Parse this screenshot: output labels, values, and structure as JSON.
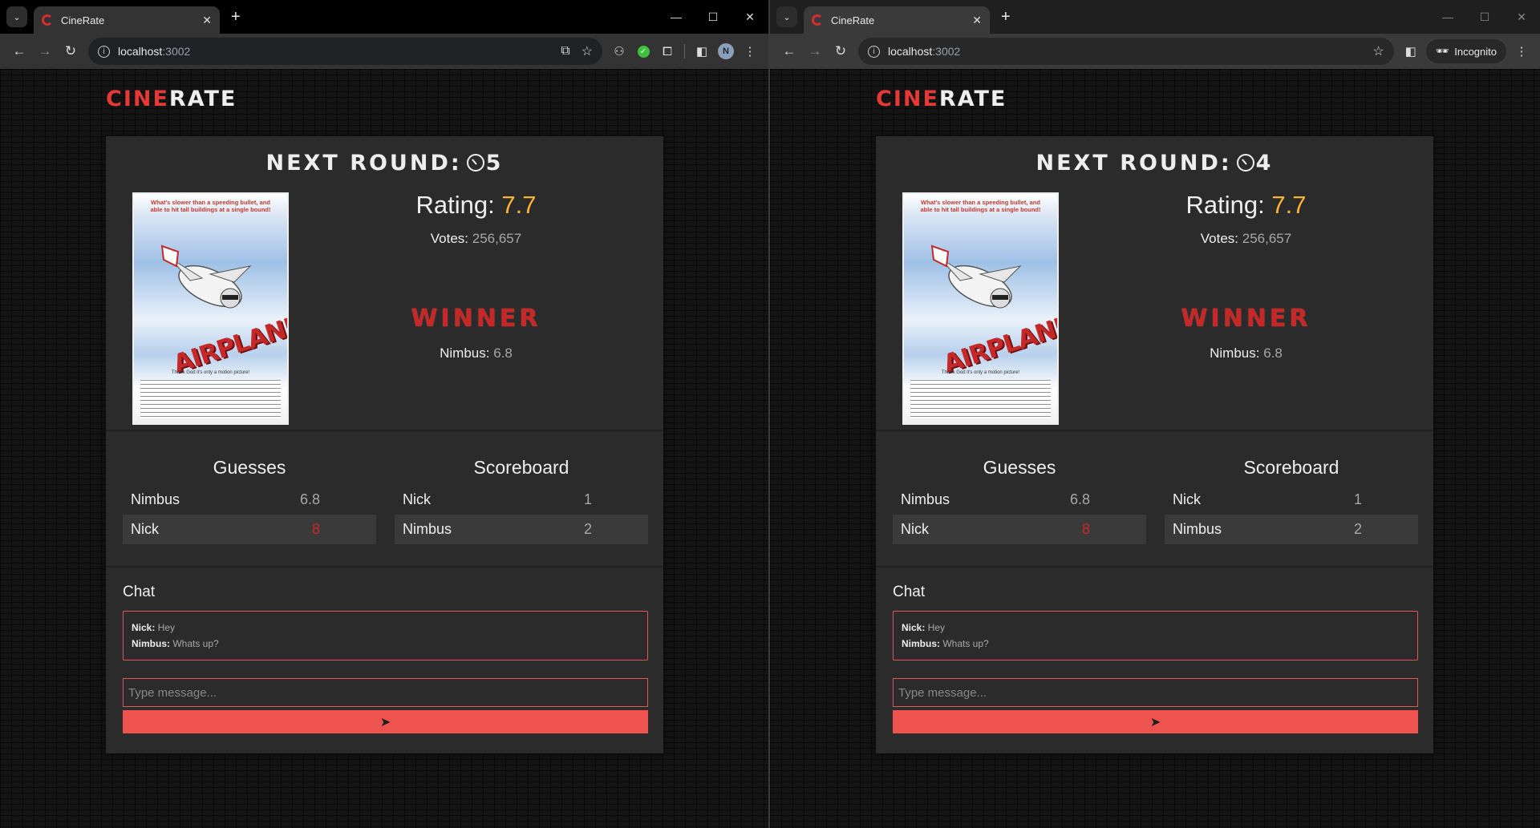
{
  "windows": [
    {
      "tab": {
        "title": "CineRate"
      },
      "url": {
        "host": "localhost",
        "port": ":3002"
      },
      "mode": "normal",
      "avatar_initial": "N",
      "page": {
        "logo": {
          "red": "CINE",
          "white": "RATE"
        },
        "round": {
          "label": "NEXT ROUND:",
          "countdown": "5"
        },
        "poster": {
          "tagline": "What's slower than a speeding bullet, and able to hit tall buildings at a single bound!",
          "title_art": "AIRPLANE!",
          "small_line": "Thank God it's only a motion picture!"
        },
        "rating": {
          "label": "Rating:",
          "value": "7.7"
        },
        "votes": {
          "label": "Votes:",
          "value": "256,657"
        },
        "winner": {
          "label": "WINNER",
          "name": "Nimbus:",
          "value": "6.8"
        },
        "guesses": {
          "title": "Guesses",
          "rows": [
            {
              "name": "Nimbus",
              "value": "6.8"
            },
            {
              "name": "Nick",
              "value": "8"
            }
          ]
        },
        "scoreboard": {
          "title": "Scoreboard",
          "rows": [
            {
              "name": "Nick",
              "value": "1"
            },
            {
              "name": "Nimbus",
              "value": "2"
            }
          ]
        },
        "chat": {
          "label": "Chat",
          "messages": [
            {
              "user": "Nick:",
              "text": "Hey"
            },
            {
              "user": "Nimbus:",
              "text": "Whats up?"
            }
          ],
          "placeholder": "Type message..."
        }
      }
    },
    {
      "tab": {
        "title": "CineRate"
      },
      "url": {
        "host": "localhost",
        "port": ":3002"
      },
      "mode": "incognito",
      "incognito_label": "Incognito",
      "page": {
        "logo": {
          "red": "CINE",
          "white": "RATE"
        },
        "round": {
          "label": "NEXT ROUND:",
          "countdown": "4"
        },
        "poster": {
          "tagline": "What's slower than a speeding bullet, and able to hit tall buildings at a single bound!",
          "title_art": "AIRPLANE!",
          "small_line": "Thank God it's only a motion picture!"
        },
        "rating": {
          "label": "Rating:",
          "value": "7.7"
        },
        "votes": {
          "label": "Votes:",
          "value": "256,657"
        },
        "winner": {
          "label": "WINNER",
          "name": "Nimbus:",
          "value": "6.8"
        },
        "guesses": {
          "title": "Guesses",
          "rows": [
            {
              "name": "Nimbus",
              "value": "6.8"
            },
            {
              "name": "Nick",
              "value": "8"
            }
          ]
        },
        "scoreboard": {
          "title": "Scoreboard",
          "rows": [
            {
              "name": "Nick",
              "value": "1"
            },
            {
              "name": "Nimbus",
              "value": "2"
            }
          ]
        },
        "chat": {
          "label": "Chat",
          "messages": [
            {
              "user": "Nick:",
              "text": "Hey"
            },
            {
              "user": "Nimbus:",
              "text": "Whats up?"
            }
          ],
          "placeholder": "Type message..."
        }
      }
    }
  ],
  "colors": {
    "accent": "#e53935",
    "rating": "#f9b233",
    "send_button": "#ef5350",
    "panel": "#2b2b2b"
  }
}
